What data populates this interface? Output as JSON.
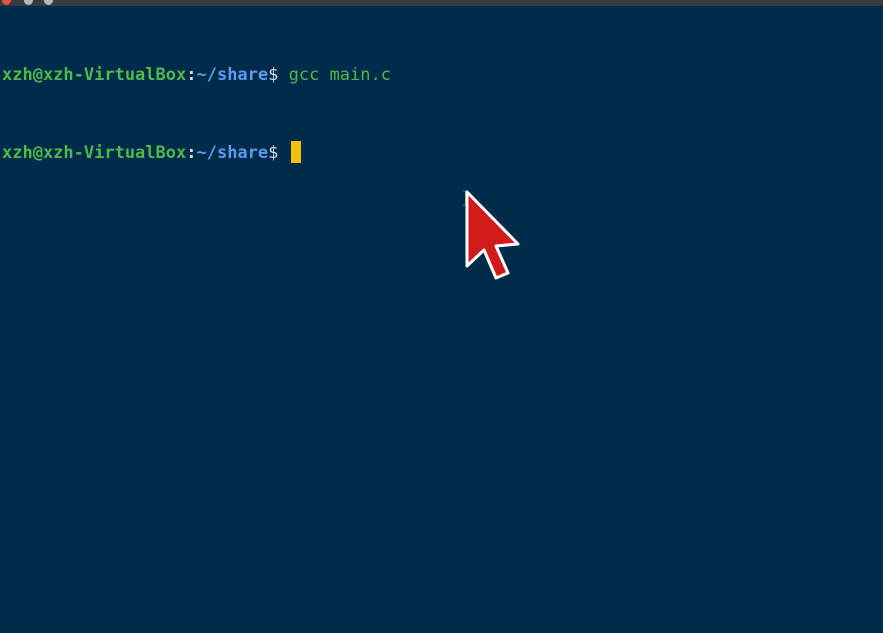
{
  "window": {
    "colors": {
      "background": "#002b4a",
      "user_host": "#4fb94a",
      "path": "#5a9cf0",
      "cursor": "#f0c20a",
      "pointer": "#d11a1a"
    }
  },
  "terminal": {
    "lines": [
      {
        "user_host": "xzh@xzh-VirtualBox",
        "colon": ":",
        "path": "~/share",
        "dollar": "$",
        "command": " gcc main.c"
      },
      {
        "user_host": "xzh@xzh-VirtualBox",
        "colon": ":",
        "path": "~/share",
        "dollar": "$",
        "command": " "
      }
    ]
  },
  "icons": {
    "mouse_pointer": "arrow-pointer-icon",
    "text_cursor": "ibeam-cursor-icon"
  }
}
